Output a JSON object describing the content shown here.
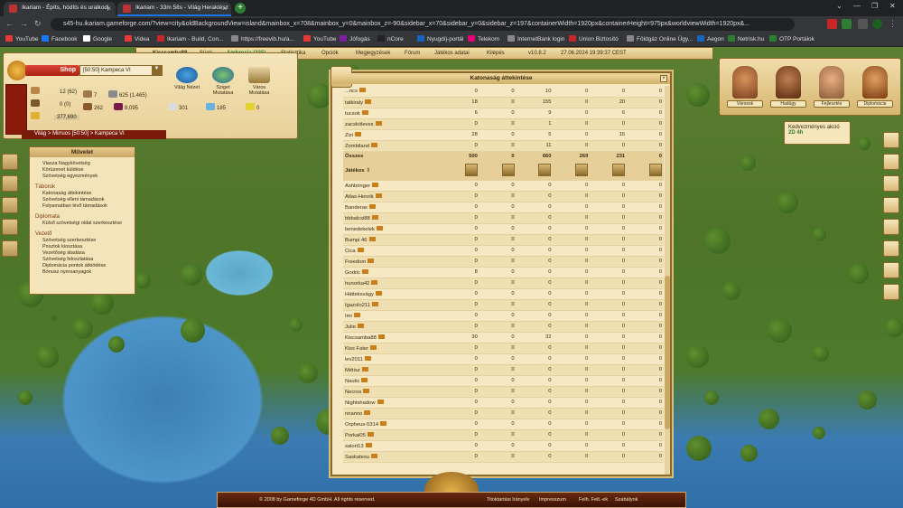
{
  "browser": {
    "tabs": [
      {
        "title": "Ikariam - Építs, hódíts és uralkodj",
        "active": false
      },
      {
        "title": "Ikariam - 33m 58s - Világ Heraklész",
        "active": true
      }
    ],
    "new_tab": "+",
    "url": "s45-hu.ikariam.gameforge.com/?view=city&oldBackgroundView=island&mainbox_x=708&mainbox_y=0&mainbox_z=-90&sidebar_x=70&sidebar_y=0&sidebar_z=197&containerWidth=1920px&containerHeight=975px&worldviewWidth=1920px&...",
    "bookmarks": [
      "YouTube",
      "Facebook",
      "Google",
      "Videa",
      "Ikariam - Build, Con...",
      "https://freevib.hu/a...",
      "YouTube",
      "Jófogás",
      "nCore",
      "Nyugdíj-portál",
      "Telekom",
      "InternetBank login",
      "Union Biztosító",
      "Földgáz Online Ügy...",
      "Aegon",
      "Netrisk.hu",
      "OTP Portálok"
    ],
    "bookmark_colors": [
      "#e53935",
      "#1877f2",
      "#ffffff",
      "#e53935",
      "#c62828",
      "#888888",
      "#e53935",
      "#7b1fa2",
      "#222222",
      "#1565c0",
      "#e20074",
      "#888888",
      "#c62828",
      "#888888",
      "#1565c0",
      "#2e7d32",
      "#2e7d32"
    ]
  },
  "topnav": {
    "player": "Kiscsamba88",
    "help": "Súgó",
    "ambrosia": "Ambrosia (335)",
    "items": [
      "Statisztika",
      "Opciók",
      "Megjegyzések",
      "Fórum",
      "Játékos adatai",
      "Kilépés",
      "v10.8.2",
      "27.06.2024 19:39:37 CEST"
    ]
  },
  "city": {
    "shop_label": "Shop",
    "city_name": "[50:50] Kampeca VI",
    "views": [
      "Világ Nézet",
      "Sziget Mutatása",
      "Város Mutatása"
    ],
    "resources": {
      "citizens": "12 (62)",
      "ships": "0 (0)",
      "gold": "377,690",
      "actions": "7",
      "population": "625 (1,465)",
      "wood": "262",
      "wine": "8,095",
      "marble": "301",
      "crystal": "185",
      "sulfur": "0"
    },
    "breadcrumb": "Világ > Mirruos [50:50] > Kampeca VI"
  },
  "action_menu": {
    "title": "Művelet",
    "sections": [
      {
        "heading": "",
        "items": [
          "Viasza Nagykövetség",
          "Körüzenet küldése",
          "Szövetség egyezmények"
        ]
      },
      {
        "heading": "Táborok",
        "items": [
          "Katonaság áttekintése",
          "Szövetség elleni támadások",
          "Folyamatban lévő támadások"
        ]
      },
      {
        "heading": "Diplomata",
        "items": [
          "Külső szövetségi oldal szerkesztése"
        ]
      },
      {
        "heading": "Vezető",
        "items": [
          "Szövetség szerkesztése",
          "Posztok kiosztása",
          "Vezetőség átadása",
          "Szövetség feloszlatása",
          "Diplomácia pontok átkiödése",
          "Bónusz nyersanyagok"
        ]
      }
    ]
  },
  "advisors": [
    "Városok",
    "Hadügy",
    "Fejlesztés",
    "Diplomácia"
  ],
  "bonus": {
    "title": "Kedvezményes akció",
    "value": "2D 4h"
  },
  "main_window": {
    "title": "Katonaság áttekintése",
    "top_rows": [
      {
        "name": "...ncs",
        "v": [
          "0",
          "0",
          "10",
          "0",
          "0",
          "0"
        ]
      },
      {
        "name": "tatkiraly",
        "v": [
          "18",
          "0",
          "155",
          "0",
          "20",
          "0"
        ]
      },
      {
        "name": "tucsok",
        "v": [
          "6",
          "0",
          "9",
          "0",
          "6",
          "0"
        ]
      },
      {
        "name": "zacskóleves",
        "v": [
          "0",
          "0",
          "1",
          "0",
          "0",
          "0"
        ]
      },
      {
        "name": "Zizi",
        "v": [
          "28",
          "0",
          "5",
          "0",
          "15",
          "0"
        ]
      },
      {
        "name": "Zombiland",
        "v": [
          "0",
          "0",
          "11",
          "0",
          "0",
          "0"
        ]
      }
    ],
    "sum_row": {
      "name": "Összes",
      "v": [
        "500",
        "0",
        "660",
        "269",
        "231",
        "0"
      ]
    },
    "players_header": "Játékos",
    "players": [
      {
        "name": "Ashbringer",
        "v": [
          "0",
          "0",
          "0",
          "0",
          "0",
          "0"
        ]
      },
      {
        "name": "Atlas-Henrik",
        "v": [
          "0",
          "0",
          "0",
          "0",
          "0",
          "0"
        ]
      },
      {
        "name": "Banderas",
        "v": [
          "0",
          "0",
          "0",
          "0",
          "0",
          "0"
        ]
      },
      {
        "name": "bbbalcsi88",
        "v": [
          "0",
          "0",
          "0",
          "0",
          "0",
          "0"
        ]
      },
      {
        "name": "benedekelek",
        "v": [
          "0",
          "0",
          "0",
          "0",
          "0",
          "0"
        ]
      },
      {
        "name": "Bumpi 46",
        "v": [
          "0",
          "0",
          "0",
          "0",
          "0",
          "0"
        ]
      },
      {
        "name": "Cica",
        "v": [
          "0",
          "0",
          "0",
          "0",
          "0",
          "0"
        ]
      },
      {
        "name": "Freedom",
        "v": [
          "0",
          "0",
          "0",
          "0",
          "0",
          "0"
        ]
      },
      {
        "name": "Godric",
        "v": [
          "8",
          "0",
          "0",
          "0",
          "0",
          "0"
        ]
      },
      {
        "name": "hunorka42",
        "v": [
          "0",
          "0",
          "0",
          "0",
          "0",
          "0"
        ]
      },
      {
        "name": "Hátteksvágy",
        "v": [
          "0",
          "0",
          "0",
          "0",
          "0",
          "0"
        ]
      },
      {
        "name": "Igazolo211",
        "v": [
          "0",
          "0",
          "0",
          "0",
          "0",
          "0"
        ]
      },
      {
        "name": "Imi",
        "v": [
          "0",
          "0",
          "0",
          "0",
          "0",
          "0"
        ]
      },
      {
        "name": "Julie",
        "v": [
          "0",
          "0",
          "0",
          "0",
          "0",
          "0"
        ]
      },
      {
        "name": "Kiscsamba88",
        "v": [
          "30",
          "0",
          "32",
          "0",
          "0",
          "0"
        ]
      },
      {
        "name": "Kiss Fater",
        "v": [
          "0",
          "0",
          "0",
          "0",
          "0",
          "0"
        ]
      },
      {
        "name": "lev2011",
        "v": [
          "0",
          "0",
          "0",
          "0",
          "0",
          "0"
        ]
      },
      {
        "name": "Métisz",
        "v": [
          "0",
          "0",
          "0",
          "0",
          "0",
          "0"
        ]
      },
      {
        "name": "Nautic",
        "v": [
          "0",
          "0",
          "0",
          "0",
          "0",
          "0"
        ]
      },
      {
        "name": "Necros",
        "v": [
          "0",
          "0",
          "0",
          "0",
          "0",
          "0"
        ]
      },
      {
        "name": "Nightshadow",
        "v": [
          "0",
          "0",
          "0",
          "0",
          "0",
          "0"
        ]
      },
      {
        "name": "nnanno",
        "v": [
          "0",
          "0",
          "0",
          "0",
          "0",
          "0"
        ]
      },
      {
        "name": "Orpheus-5314",
        "v": [
          "0",
          "0",
          "0",
          "0",
          "0",
          "0"
        ]
      },
      {
        "name": "Porkai05",
        "v": [
          "0",
          "0",
          "0",
          "0",
          "0",
          "0"
        ]
      },
      {
        "name": "salort13",
        "v": [
          "0",
          "0",
          "0",
          "0",
          "0",
          "0"
        ]
      },
      {
        "name": "Saskatesu",
        "v": [
          "0",
          "0",
          "0",
          "0",
          "0",
          "0"
        ]
      }
    ]
  },
  "footer": {
    "copyright": "© 2008 by Gameforge 4D GmbH. All rights reserved.",
    "links": [
      "Titoktartási Irányelv",
      "Impresszum",
      "Felh. Felt.-ek",
      "Szabályok"
    ]
  }
}
